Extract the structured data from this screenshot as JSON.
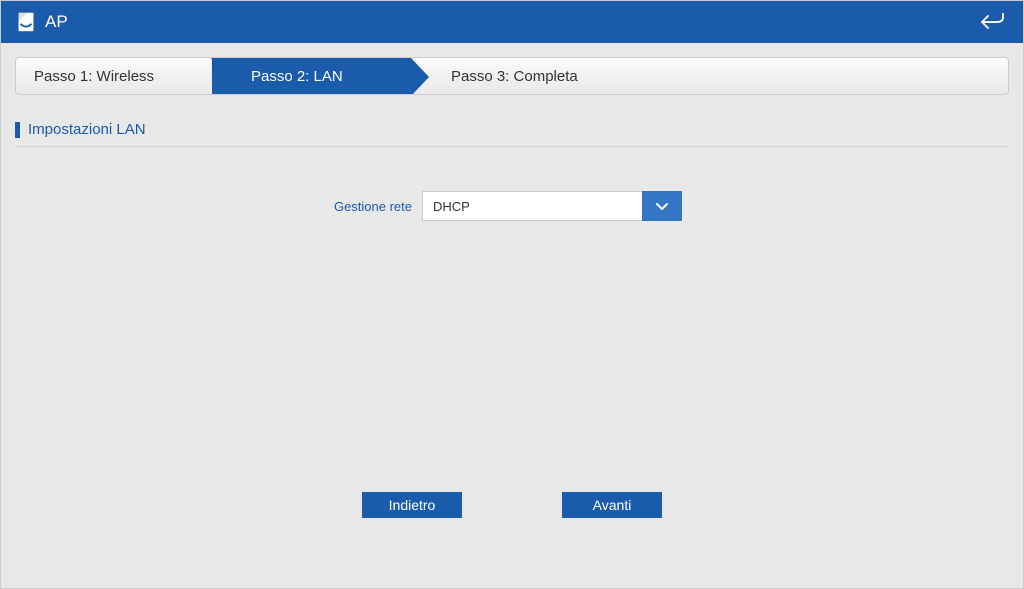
{
  "titlebar": {
    "title": "AP"
  },
  "stepper": {
    "step1": "Passo 1: Wireless",
    "step2": "Passo 2:  LAN",
    "step3": "Passo 3: Completa"
  },
  "section": {
    "title": "Impostazioni LAN"
  },
  "form": {
    "network_label": "Gestione rete",
    "network_value": "DHCP"
  },
  "buttons": {
    "back": "Indietro",
    "next": "Avanti"
  }
}
